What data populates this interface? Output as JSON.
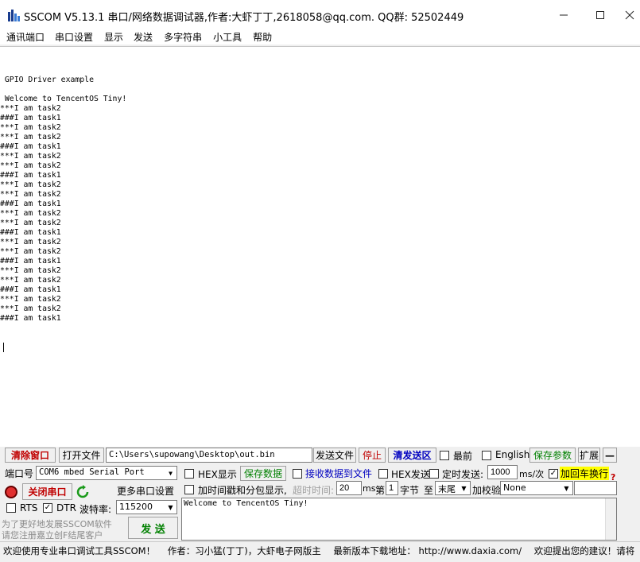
{
  "window": {
    "title": "SSCOM V5.13.1 串口/网络数据调试器,作者:大虾丁丁,2618058@qq.com. QQ群: 52502449",
    "minimize": "—",
    "maximize": "☐",
    "close": "✕"
  },
  "menu": [
    "通讯端口",
    "串口设置",
    "显示",
    "发送",
    "多字符串",
    "小工具",
    "帮助"
  ],
  "output": {
    "lines": [
      "",
      " GPIO Driver example",
      "",
      " Welcome to TencentOS Tiny!",
      "***I am task2",
      "###I am task1",
      "***I am task2",
      "***I am task2",
      "###I am task1",
      "***I am task2",
      "***I am task2",
      "###I am task1",
      "***I am task2",
      "***I am task2",
      "###I am task1",
      "***I am task2",
      "***I am task2",
      "###I am task1",
      "***I am task2",
      "***I am task2",
      "###I am task1",
      "***I am task2",
      "***I am task2",
      "###I am task1",
      "***I am task2",
      "***I am task2",
      "###I am task1"
    ]
  },
  "toolbar": {
    "clear_window": "清除窗口",
    "open_file": "打开文件",
    "file_path": "C:\\Users\\supowang\\Desktop\\out.bin",
    "send_file": "发送文件",
    "stop": "停止",
    "clear_send": "清发送区",
    "last_label": "最前",
    "english_label": "English",
    "save_params": "保存参数",
    "expand": "扩展",
    "collapse": "—"
  },
  "port": {
    "port_label": "端口号",
    "port_value": "COM6 mbed Serial Port",
    "close_port": "关闭串口",
    "more_settings": "更多串口设置",
    "rts_label": "RTS",
    "dtr_label": "DTR",
    "baud_label": "波特率:",
    "baud_value": "115200",
    "promo_line1": "为了更好地发展SSCOM软件",
    "promo_line2": "请您注册嘉立创F结尾客户",
    "send_button": "发 送"
  },
  "options": {
    "hex_display": "HEX显示",
    "save_data": "保存数据",
    "receive_to_file": "接收数据到文件",
    "hex_send": "HEX发送",
    "timed_send": "定时发送:",
    "interval_value": "1000",
    "interval_unit": "ms/次",
    "add_crlf": "加回车换行",
    "help_mark": "?",
    "timestamp_label": "加时间戳和分包显示,",
    "timeout_label": "超时时间:",
    "timeout_value": "20",
    "timeout_unit": "ms",
    "byte_label_prefix": "第",
    "byte_index": "1",
    "byte_label_suffix": "字节",
    "to_label": "至",
    "end_value": "末尾",
    "checksum_label": "加校验",
    "checksum_value": "None"
  },
  "send_text": "Welcome to TencentOS Tiny!",
  "status": {
    "welcome": "欢迎使用专业串口调试工具SSCOM！",
    "author": "作者：习小猛(丁丁)，大虾电子网版主",
    "download": "最新版本下载地址： http://www.daxia.com/",
    "suggest": "欢迎提出您的建议！请将"
  },
  "colors": {
    "red_button": "#c00000",
    "green_button": "#008000",
    "blue_button": "#0000c0",
    "highlight_yellow": "#ffff00"
  }
}
